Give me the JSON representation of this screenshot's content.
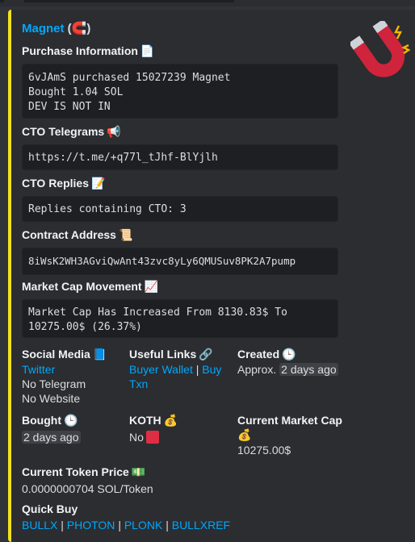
{
  "embed": {
    "accent_color": "#f4e11b",
    "title": "Magnet",
    "title_emoji": "(🧲)",
    "thumbnail_icon": "magnet-icon"
  },
  "fields": {
    "purchase": {
      "name": "Purchase Information",
      "emoji": "📄",
      "lines": [
        "6vJAmS purchased 15027239 Magnet",
        "Bought 1.04 SOL",
        "DEV IS NOT IN"
      ]
    },
    "telegrams": {
      "name": "CTO Telegrams",
      "emoji": "📢",
      "value": "https://t.me/+q77l_tJhf-BlYjlh"
    },
    "replies": {
      "name": "CTO Replies",
      "emoji": "📝",
      "value": "Replies containing CTO: 3"
    },
    "contract": {
      "name": "Contract Address",
      "emoji": "📜",
      "value": "8iWsK2WH3AGviQwAnt43zvc8yLy6QMUSuv8PK2A7pump"
    },
    "market_cap": {
      "name": "Market Cap Movement",
      "emoji": "📈",
      "value": "Market Cap Has Increased From 8130.83$ To 10275.00$ (26.37%)"
    },
    "social": {
      "name": "Social Media",
      "emoji": "📘",
      "twitter": "Twitter",
      "telegram": "No Telegram",
      "website": "No Website"
    },
    "links": {
      "name": "Useful Links",
      "emoji": "🔗",
      "buyer_wallet": "Buyer Wallet",
      "separator": "|",
      "buy": "Buy",
      "txn": "Txn"
    },
    "created": {
      "name": "Created",
      "emoji": "🕒",
      "prefix": "Approx.",
      "value": "2 days ago"
    },
    "bought": {
      "name": "Bought",
      "emoji": "🕒",
      "value": "2 days ago"
    },
    "koth": {
      "name": "KOTH",
      "emoji": "💰",
      "value": "No"
    },
    "current_mc": {
      "name": "Current Market Cap",
      "emoji": "💰",
      "value": "10275.00$"
    },
    "token_price": {
      "name": "Current Token Price",
      "emoji": "💵",
      "value": "0.0000000704 SOL/Token"
    },
    "quick_buy": {
      "name": "Quick Buy",
      "links": [
        "BULLX",
        "PHOTON",
        "PLONK",
        "BULLXREF"
      ],
      "separator": "|"
    }
  }
}
